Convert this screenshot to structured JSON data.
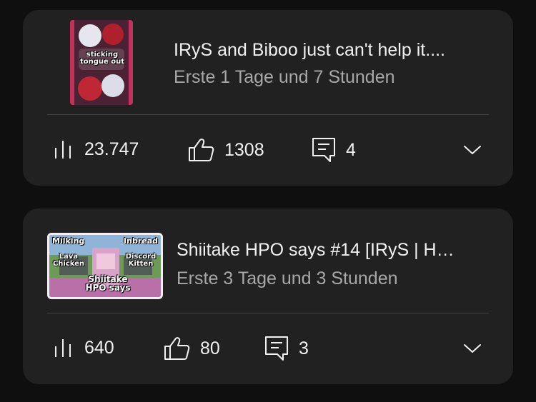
{
  "videos": [
    {
      "title": "IRyS and Biboo just can't help it....",
      "published": "Erste 1 Tage und 7 Stunden",
      "thumbnail_text": [
        "sticking",
        "tongue out"
      ],
      "views": "23.747",
      "likes": "1308",
      "comments": "4"
    },
    {
      "title": "Shiitake HPO says #14 [IRyS | H…",
      "published": "Erste 3 Tage und 3 Stunden",
      "thumbnail_text": [
        "Milking",
        "Inbread",
        "Lava Chicken",
        "Discord Kitten",
        "Shiitake HPO says"
      ],
      "views": "640",
      "likes": "80",
      "comments": "3"
    }
  ],
  "icons": {
    "views": "bar-chart-icon",
    "likes": "thumbs-up-icon",
    "comments": "comment-icon",
    "expand": "chevron-down-icon"
  }
}
